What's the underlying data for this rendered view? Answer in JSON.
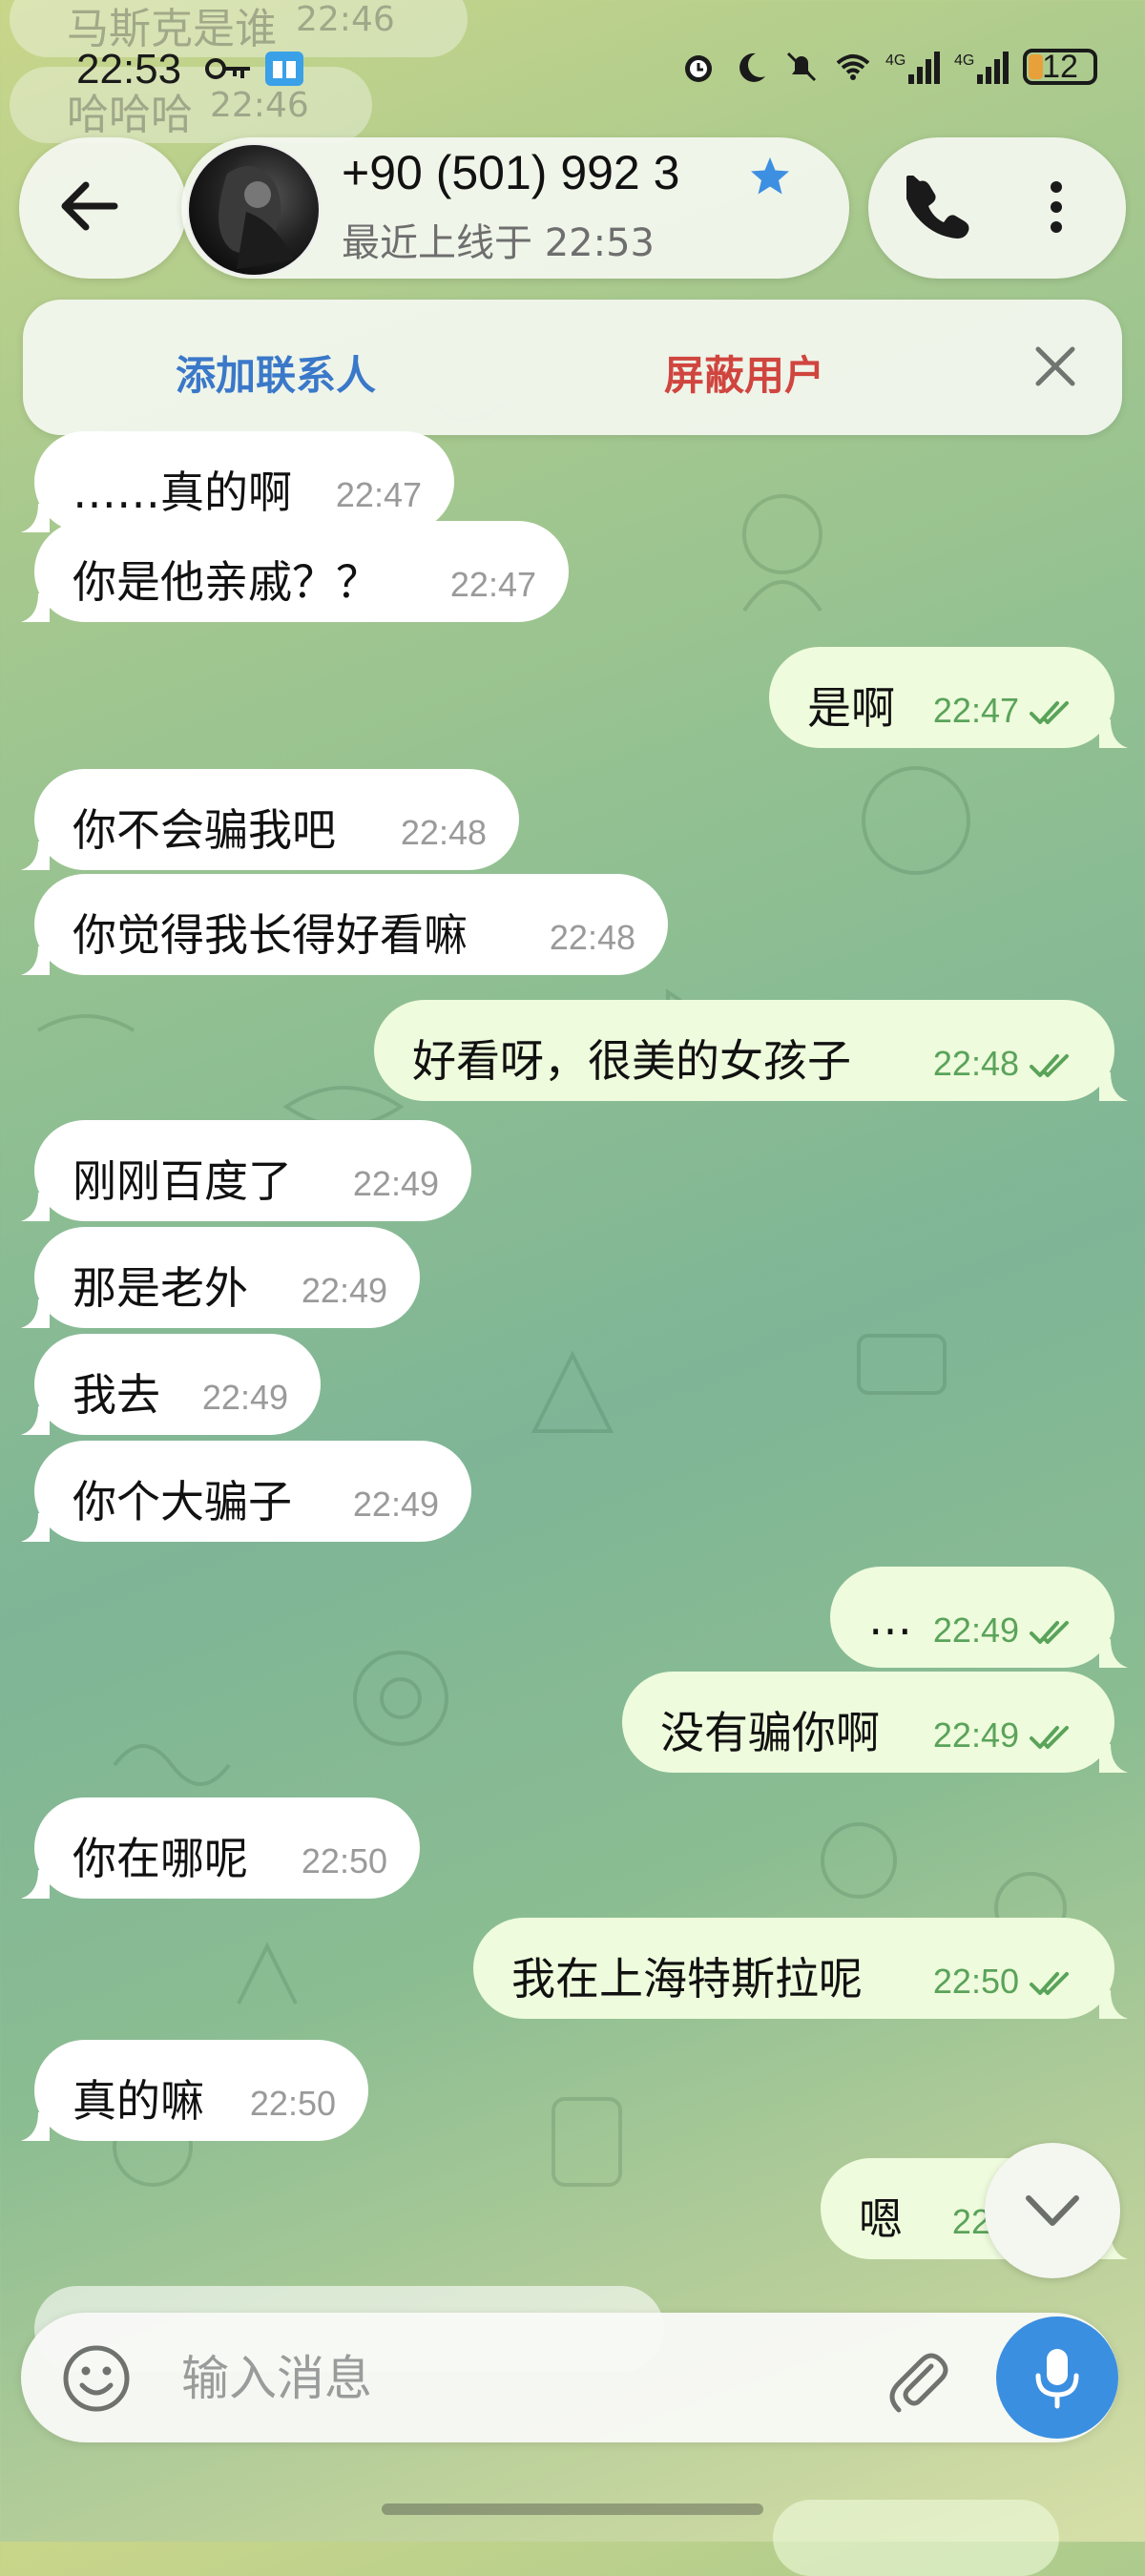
{
  "status_bar": {
    "time": "22:53",
    "battery": "12",
    "network_1": "4G",
    "network_2": "4G"
  },
  "header": {
    "contact_name": "+90 (501) 992 3",
    "last_seen": "最近上线于 22:53"
  },
  "banner": {
    "add_contact": "添加联系人",
    "block_user": "屏蔽用户"
  },
  "ghost_messages": [
    {
      "text": "马斯克是谁",
      "time": "22:46"
    },
    {
      "text": "哈哈哈",
      "time": "22:46"
    }
  ],
  "messages": [
    {
      "side": "in",
      "text": "……真的啊",
      "time": "22:47"
    },
    {
      "side": "in",
      "text": "你是他亲戚？？",
      "time": "22:47"
    },
    {
      "side": "out",
      "text": "是啊",
      "time": "22:47",
      "read": true
    },
    {
      "side": "in",
      "text": "你不会骗我吧",
      "time": "22:48"
    },
    {
      "side": "in",
      "text": "你觉得我长得好看嘛",
      "time": "22:48"
    },
    {
      "side": "out",
      "text": "好看呀，很美的女孩子",
      "time": "22:48",
      "read": true
    },
    {
      "side": "in",
      "text": "刚刚百度了",
      "time": "22:49"
    },
    {
      "side": "in",
      "text": "那是老外",
      "time": "22:49"
    },
    {
      "side": "in",
      "text": "我去",
      "time": "22:49"
    },
    {
      "side": "in",
      "text": "你个大骗子",
      "time": "22:49"
    },
    {
      "side": "out",
      "text": "…",
      "time": "22:49",
      "read": true
    },
    {
      "side": "out",
      "text": "没有骗你啊",
      "time": "22:49",
      "read": true
    },
    {
      "side": "in",
      "text": "你在哪呢",
      "time": "22:50"
    },
    {
      "side": "out",
      "text": "我在上海特斯拉呢",
      "time": "22:50",
      "read": true
    },
    {
      "side": "in",
      "text": "真的嘛",
      "time": "22:50"
    },
    {
      "side": "out",
      "text": "嗯",
      "time": "22:5",
      "read": true
    }
  ],
  "input": {
    "placeholder": "输入消息"
  },
  "colors": {
    "incoming_bubble": "#ffffff",
    "outgoing_bubble": "#eefbdc",
    "read_check": "#5aa35a",
    "add_contact": "#3a78c9",
    "block_user": "#d0453f",
    "mic_button": "#3b8fe0"
  }
}
